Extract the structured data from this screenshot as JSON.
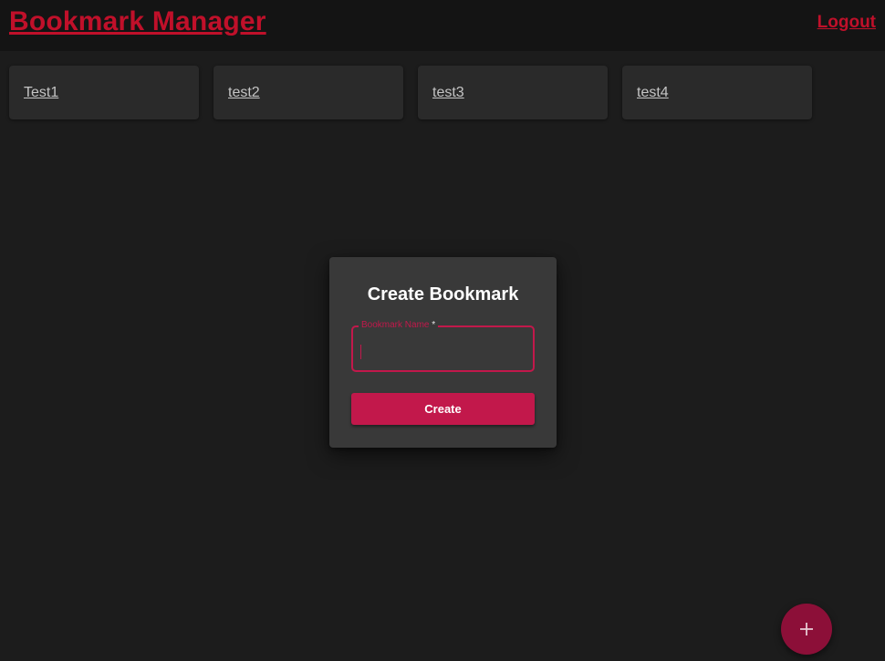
{
  "header": {
    "title": "Bookmark Manager",
    "logout_label": "Logout"
  },
  "bookmarks": [
    {
      "label": "Test1"
    },
    {
      "label": "test2"
    },
    {
      "label": "test3"
    },
    {
      "label": "test4"
    }
  ],
  "dialog": {
    "title": "Create Bookmark",
    "field_label": "Bookmark Name",
    "required_marker": "*",
    "field_value": "",
    "create_label": "Create"
  },
  "fab": {
    "icon": "plus-icon"
  },
  "colors": {
    "accent": "#c2184b",
    "title_red": "#c0102a",
    "fab": "#8c0f38",
    "background": "#1c1c1c",
    "card": "#2a2a2a",
    "dialog": "#393939"
  }
}
